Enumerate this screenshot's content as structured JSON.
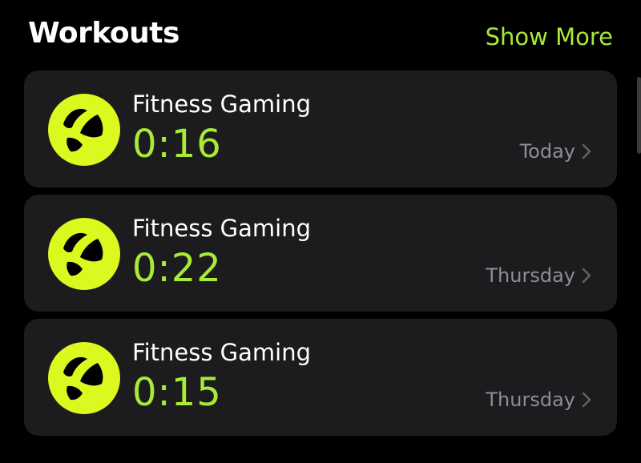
{
  "header": {
    "title": "Workouts",
    "show_more_label": "Show More"
  },
  "workouts": [
    {
      "activity": "Fitness Gaming",
      "duration": "0:16",
      "date": "Today",
      "icon": "fitness-gaming-icon"
    },
    {
      "activity": "Fitness Gaming",
      "duration": "0:22",
      "date": "Thursday",
      "icon": "fitness-gaming-icon"
    },
    {
      "activity": "Fitness Gaming",
      "duration": "0:15",
      "date": "Thursday",
      "icon": "fitness-gaming-icon"
    }
  ],
  "colors": {
    "background": "#000000",
    "card": "#1c1c1e",
    "accent": "#a8ea37",
    "icon": "#dbf81f",
    "secondary_text": "#8e8e93"
  }
}
